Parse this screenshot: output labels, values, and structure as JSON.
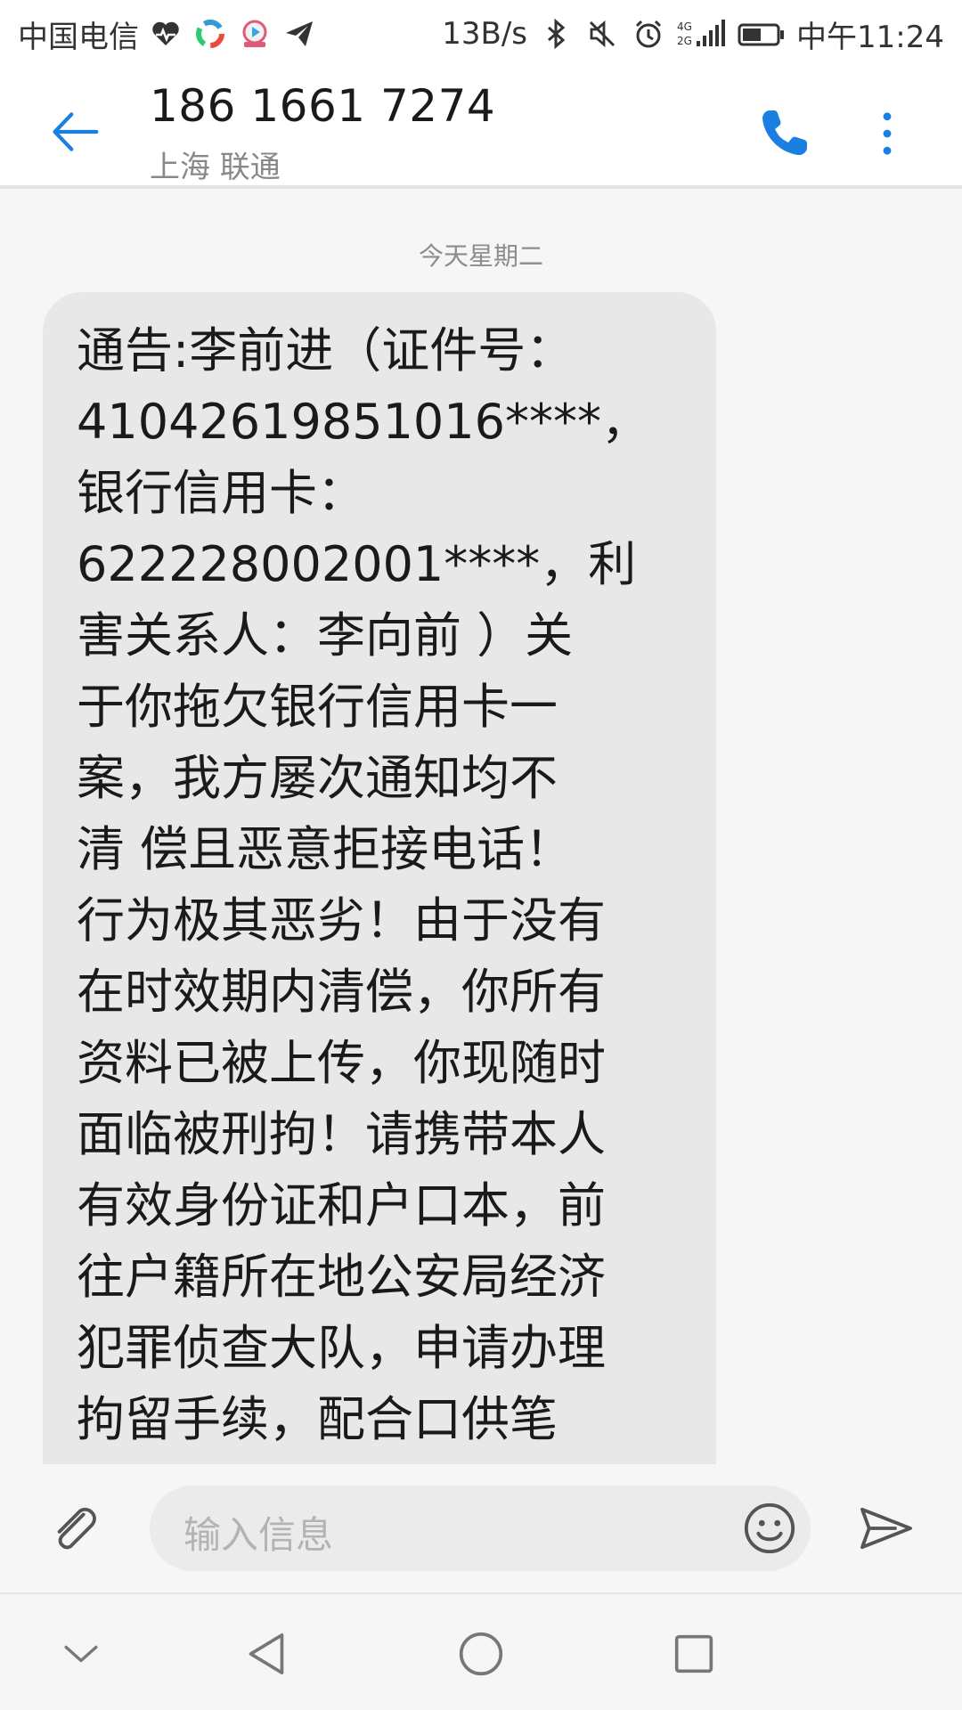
{
  "status_bar": {
    "carrier": "中国电信",
    "net_speed": "13B/s",
    "network_type": "4G 2G",
    "time": "中午11:24",
    "icons": [
      "heart-monitor-icon",
      "color-wheel-app-icon",
      "video-app-icon",
      "paper-plane-icon",
      "bluetooth-icon",
      "mute-icon",
      "alarm-icon",
      "signal-icon",
      "battery-icon"
    ]
  },
  "header": {
    "back_icon": "arrow-left-icon",
    "contact_number": "186 1661 7274",
    "contact_location": "上海 联通",
    "call_icon": "phone-icon",
    "more_icon": "more-vertical-icon"
  },
  "conversation": {
    "date_separator": "今天星期二",
    "messages": [
      {
        "direction": "incoming",
        "text": "通告:李前进（证件号：41042619851016****，银行信用卡：622228002001****，利害关系人：李向前 ）关于你拖欠银行信用卡一案，我方屡次通知均不清 偿且恶意拒接电话！行为极其恶劣！由于没有在时效期内清偿，你所有资料已被上传，你现随时面临被刑拘！请携带本人有效身份证和户口本，前往户籍所在地公安局经济犯罪侦查大队，申请办理拘留手续，配合口供笔",
        "lines": [
          "通告:李前进（证件号：",
          "41042619851016****，",
          "银行信用卡：",
          "622228002001****，利",
          "害关系人：李向前 ）关",
          "于你拖欠银行信用卡一",
          "案，我方屡次通知均不",
          "清 偿且恶意拒接电话！",
          "行为极其恶劣！由于没有",
          "在时效期内清偿，你所有",
          "资料已被上传，你现随时",
          "面临被刑拘！请携带本人",
          "有效身份证和户口本，前",
          "往户籍所在地公安局经济",
          "犯罪侦查大队，申请办理",
          "拘留手续，配合口供笔"
        ]
      }
    ]
  },
  "compose": {
    "attach_icon": "paperclip-icon",
    "placeholder": "输入信息",
    "emoji_icon": "smiley-icon",
    "send_icon": "send-icon"
  },
  "nav_bar": {
    "icons": [
      "chevron-down-icon",
      "back-triangle-icon",
      "home-circle-icon",
      "recents-square-icon"
    ]
  },
  "colors": {
    "accent": "#1a7fe0",
    "bubble": "#e8e8e8",
    "background": "#f6f6f6"
  }
}
